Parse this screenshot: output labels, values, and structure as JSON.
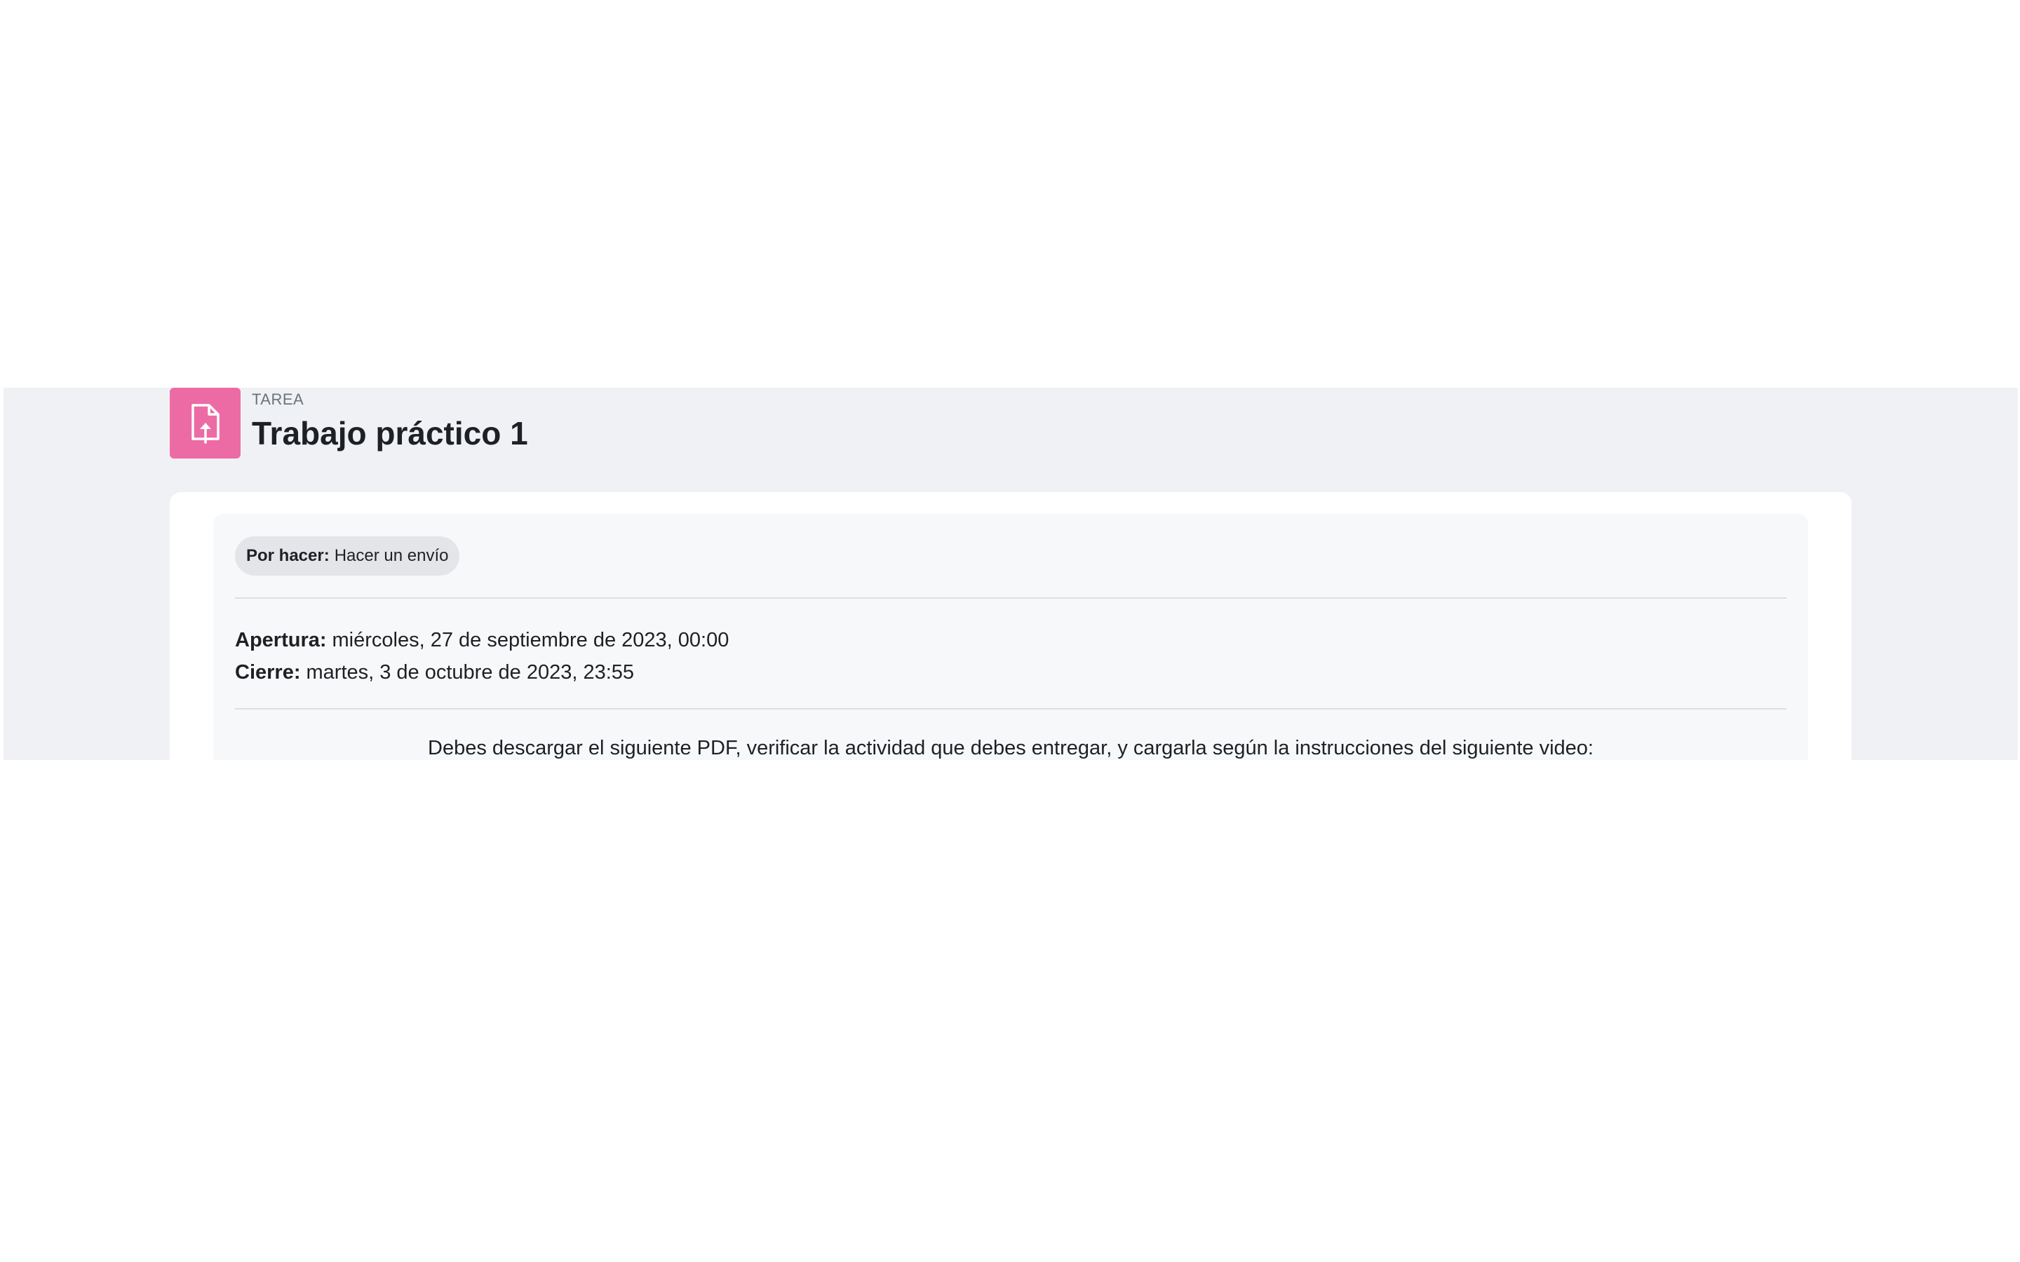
{
  "header": {
    "activity_type": "TAREA",
    "title": "Trabajo práctico 1",
    "icon": "assignment-upload-icon",
    "icon_color": "#ed6ba4"
  },
  "status": {
    "label": "Por hacer:",
    "value": "Hacer un envío"
  },
  "dates": {
    "opening_label": "Apertura:",
    "opening_value": "miércoles, 27 de septiembre de 2023, 00:00",
    "closing_label": "Cierre:",
    "closing_value": "martes, 3 de octubre de 2023, 23:55"
  },
  "description": {
    "text": "Debes descargar el siguiente PDF, verificar la actividad que debes entregar, y cargarla según la instrucciones del siguiente video:"
  },
  "colors": {
    "band_background": "#f0f1f5",
    "card_background": "#ffffff",
    "inner_background": "#f7f8fa",
    "badge_background": "#e4e5e8"
  }
}
